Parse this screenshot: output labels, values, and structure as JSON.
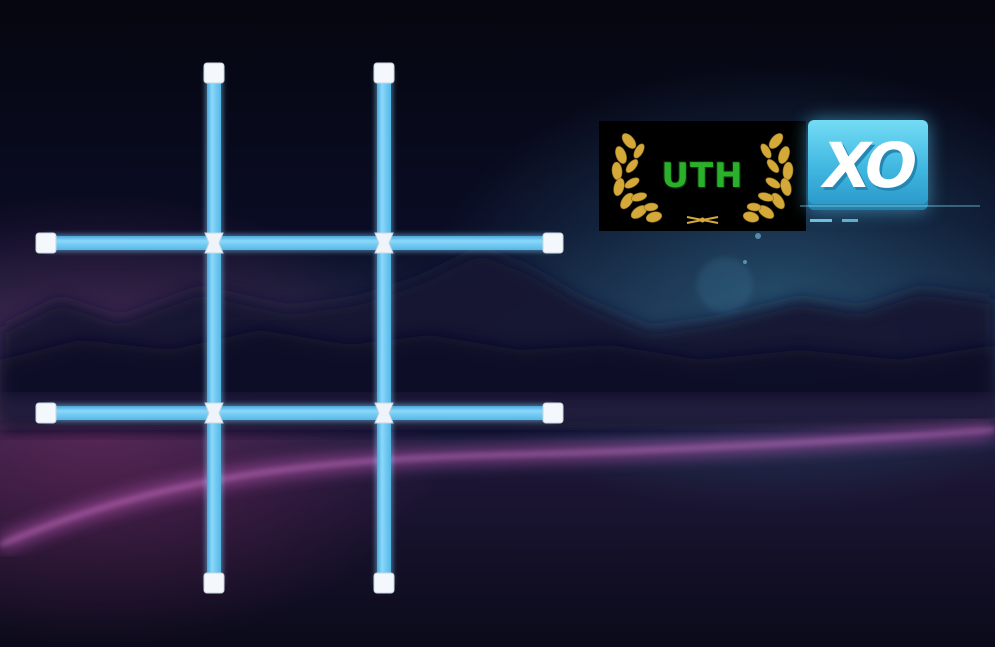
{
  "game": {
    "title": "XO",
    "board": {
      "rows": 3,
      "cols": 3,
      "cells": [
        "",
        "",
        "",
        "",
        "",
        "",
        "",
        "",
        ""
      ]
    }
  },
  "badge": {
    "text": "UTH",
    "icon": "laurel-wreath-icon"
  },
  "logo": {
    "text": "XO",
    "icon": "xo-logo-icon"
  },
  "colors": {
    "background": "#07081a",
    "grid_line": "#6ecdf4",
    "grid_cap": "#f4f7fb",
    "logo_tile": "#4fc3ea",
    "badge_text": "#2bb02b",
    "laurel": "#d4a93a"
  }
}
